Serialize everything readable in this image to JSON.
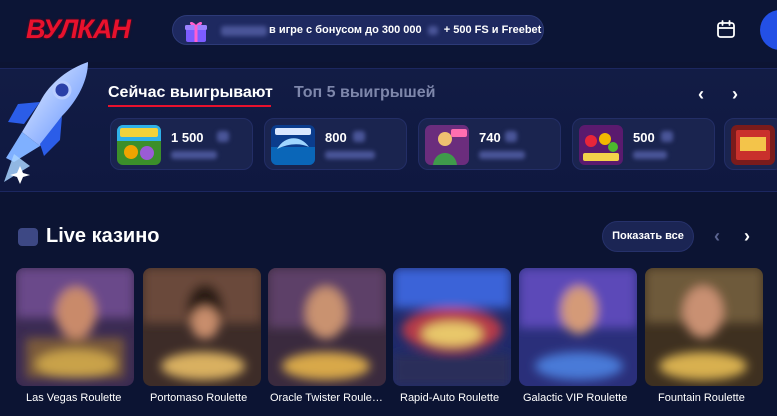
{
  "header": {
    "logo": "ВУЛКАН",
    "promo_text": "в игре с бонусом до 300 000",
    "promo_suffix": "+ 500 FS и Freebet"
  },
  "winners": {
    "tabs": [
      {
        "label": "Сейчас выигрывают",
        "active": true
      },
      {
        "label": "Топ 5 выигрышей",
        "active": false
      }
    ],
    "prev_arrow": "‹",
    "next_arrow": "›",
    "items": [
      {
        "amount": "1 500",
        "game_icon": "fruit-slot-icon"
      },
      {
        "amount": "800",
        "game_icon": "dolphins-pearl-icon"
      },
      {
        "amount": "740",
        "game_icon": "lucky-lady-icon"
      },
      {
        "amount": "500",
        "game_icon": "fruits-slot-icon"
      }
    ]
  },
  "live": {
    "title": "Live казино",
    "show_all": "Показать все",
    "prev_arrow": "‹",
    "next_arrow": "›",
    "games": [
      {
        "name": "Las Vegas Roulette"
      },
      {
        "name": "Portomaso Roulette"
      },
      {
        "name": "Oracle Twister Roule…"
      },
      {
        "name": "Rapid-Auto Roulette"
      },
      {
        "name": "Galactic VIP Roulette"
      },
      {
        "name": "Fountain Roulette"
      }
    ]
  },
  "colors": {
    "background": "#0c1433",
    "brand_red": "#e8112d",
    "accent_blue": "#2350e6"
  }
}
